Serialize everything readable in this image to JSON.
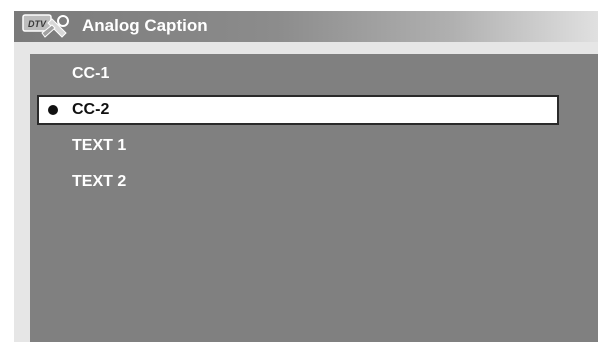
{
  "window": {
    "title": "Analog Caption",
    "icon": "dtv-settings-icon"
  },
  "menu": {
    "items": [
      {
        "label": "CC-1",
        "selected": false
      },
      {
        "label": "CC-2",
        "selected": true
      },
      {
        "label": "TEXT 1",
        "selected": false
      },
      {
        "label": "TEXT 2",
        "selected": false
      }
    ]
  },
  "colors": {
    "title_bar": "#7a7a7a",
    "panel": "#808080",
    "selection": "#ffffff",
    "frame": "#e6e6e6"
  }
}
